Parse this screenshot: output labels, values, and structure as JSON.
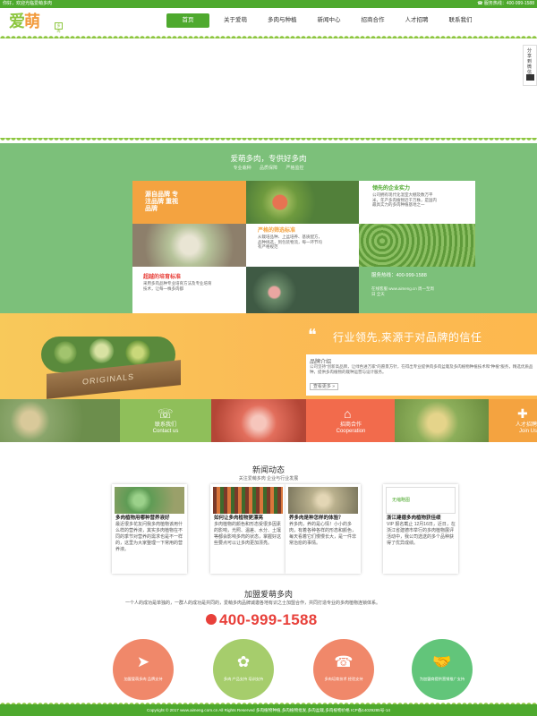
{
  "topbar": {
    "left_text": "你好，欢迎光临爱萌多肉",
    "right_text": "☎ 服务热线：400-999-1588"
  },
  "logo": {
    "text_a": "爱",
    "text_b": "萌",
    "badge": "多肉"
  },
  "nav": [
    "首页",
    "关于爱萌",
    "多肉与种植",
    "新闻中心",
    "招商合作",
    "人才招聘",
    "联系我们"
  ],
  "side": {
    "label": "分享到微信"
  },
  "feature": {
    "title": "爱萌多肉，专供好多肉",
    "tabs": [
      "专业栽种",
      "品质保障",
      "严格监控"
    ],
    "tile_a": {
      "title": "源自品牌 专注品牌 重视品牌"
    },
    "tile_b": {
      "title": "领先的企业实力",
      "text": "公司拥有现代化温室大棚及数万平米，年产多肉植物近千万株，是国内最具实力的多肉种植基地之一"
    },
    "tile_c": {
      "title": "严格的筛选标准",
      "text": "从栽培品种、上盆培养、基质配方，品种挑选，到包装物流，每一环节均有严格规范"
    },
    "tile_d": {
      "title": "超越的培育标准",
      "text": "采用多肉品种专业培育方法及专业培育技术，让每一株多肉都"
    },
    "tile_e": {
      "phone": "服务热线：400-999-1588",
      "text": "在线客服 www.aimeng.cn 周一至周日 全天"
    }
  },
  "banner": {
    "quote": "❝",
    "slogan": "行业领先,来源于对品牌的信任",
    "card_title": "品牌介绍",
    "card_text": "公司坚持\"创新高品牌，让绿色进万家\"的愿景方针，在得出专业提供肉多肉盆栽及多肉植物种植技术和\"种植\"服务，精选优质品种，提供多肉植物的栽种运营与设计服务。",
    "more": "查看更多 »",
    "crate_label": "ORIGINALS"
  },
  "strip": [
    {
      "icon": "☏",
      "label_a": "联系我们",
      "label_b": "Contact us",
      "color": "#8fbf5a"
    },
    {
      "icon": "⌂",
      "label_a": "招商合作",
      "label_b": "Cooperation",
      "color": "#f26b4c"
    },
    {
      "icon": "✚",
      "label_a": "人才招聘",
      "label_b": "Join Us",
      "color": "#f4a340"
    }
  ],
  "news": {
    "title": "新闻动态",
    "sub": "关注爱萌多肉    企业与行业发展",
    "cards": [
      {
        "title": "多肉植物用哪种营养液好",
        "text": "最近很多花友问我多肉植物该用什么样的营养液，其实多肉植物在不同的季节对营养的需求也是不一样的，这里为大家整理一下常用的营养液。"
      },
      {
        "title": "如何让多肉植物更漂亮",
        "text": "多肉植物的颜色和形态受很多因素的影响，光照、温差、水分、土壤等都会影响多肉的状态，掌握好这些要点可以让多肉更加漂亮。"
      },
      {
        "title": "养多肉是种怎样的体验？",
        "text": "养多肉，养的是心情！小小的多肉，有着各种各样的形态和颜色，每天看着它们慢慢长大，是一件非常治愈的事情。"
      },
      {
        "title": "浙江建德多肉植物获佳绩",
        "text": "VIP 报名截止 12月16日，近日，在浙江省建德市举行的多肉植物展评活动中，我公司选送的多个品种获得了优异成绩。"
      }
    ],
    "card4_img_label": "无缩略图"
  },
  "join": {
    "title": "加盟爱萌多肉",
    "desc": "一个人的成功是单独的，一群人的成功是共同的，爱萌多肉品牌诚邀各地有识之士加盟合作，共同打造专业的多肉植物连锁体系。",
    "phone": "400-999-1588",
    "circles": [
      {
        "icon": "➤",
        "label": "加盟爱萌多肉 品牌支持",
        "color": "#f0886a"
      },
      {
        "icon": "✿",
        "label": "多肉 产品支持 培训支持",
        "color": "#a6cd6c"
      },
      {
        "icon": "☎",
        "label": "多肉培育技术 经验支持",
        "color": "#f0886a"
      },
      {
        "icon": "🤝",
        "label": "为加盟商提供营销推广支持",
        "color": "#62c57a"
      }
    ]
  },
  "footer": {
    "text": "Copyright © 2017 www.aimeng.com.cn All Rights Reserved 多肉植物种植,多肉植物批发,多肉盆栽,多肉植物价格 ICP备14029285号-14"
  }
}
